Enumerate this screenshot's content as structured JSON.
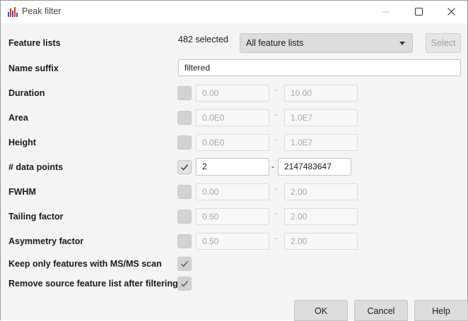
{
  "window": {
    "title": "Peak filter",
    "accent_color": "#d13b2a"
  },
  "feature_lists": {
    "label": "Feature lists",
    "selected_text": "482 selected",
    "combo_value": "All feature lists",
    "select_label": "Select"
  },
  "name_suffix": {
    "label": "Name suffix",
    "value": "filtered"
  },
  "duration": {
    "label": "Duration",
    "checked": false,
    "min": "0.00",
    "dash": "-",
    "max": "10.00"
  },
  "area": {
    "label": "Area",
    "checked": false,
    "min": "0.0E0",
    "dash": "-",
    "max": "1.0E7"
  },
  "height": {
    "label": "Height",
    "checked": false,
    "min": "0.0E0",
    "dash": "-",
    "max": "1.0E7"
  },
  "data_points": {
    "label": "# data points",
    "checked": true,
    "min": "2",
    "dash": "-",
    "max": "2147483647"
  },
  "fwhm": {
    "label": "FWHM",
    "checked": false,
    "min": "0.00",
    "dash": "-",
    "max": "2.00"
  },
  "tailing": {
    "label": "Tailing factor",
    "checked": false,
    "min": "0.50",
    "dash": "-",
    "max": "2.00"
  },
  "asymmetry": {
    "label": "Asymmetry factor",
    "checked": false,
    "min": "0.50",
    "dash": "-",
    "max": "2.00"
  },
  "keep_msms": {
    "label": "Keep only features with MS/MS scan",
    "checked": true
  },
  "remove_source": {
    "label": "Remove source feature list after filtering",
    "checked": true
  },
  "footer": {
    "ok_label": "OK",
    "cancel_label": "Cancel",
    "help_label": "Help"
  }
}
